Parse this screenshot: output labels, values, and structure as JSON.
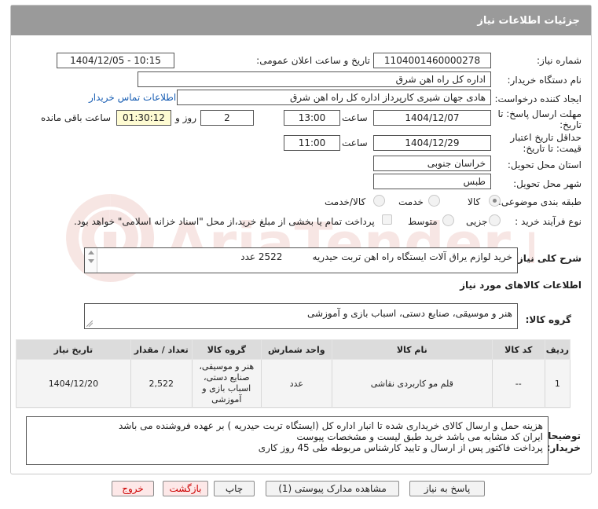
{
  "header": {
    "title": "جزئیات اطلاعات نیاز"
  },
  "fields": {
    "need_number_label": "شماره نیاز:",
    "need_number": "1104001460000278",
    "announce_label": "تاریخ و ساعت اعلان عمومی:",
    "announce_value": "1404/12/05 - 10:15",
    "buyer_org_label": "نام دستگاه خریدار:",
    "buyer_org": "اداره کل راه اهن شرق",
    "requester_label": "ایجاد کننده درخواست:",
    "requester": "هادی جهان شیری کارپرداز اداره کل راه اهن شرق",
    "contact_link": "اطلاعات تماس خریدار",
    "reply_deadline_label_1": "مهلت ارسال پاسخ: تا",
    "reply_deadline_label_2": "تاریخ:",
    "reply_date": "1404/12/07",
    "time_label": "ساعت",
    "reply_time": "13:00",
    "days_value": "2",
    "days_label": "روز و",
    "remaining_time": "01:30:12",
    "remaining_label": "ساعت باقی مانده",
    "validity_label_1": "حداقل تاریخ اعتبار",
    "validity_label_2": "قیمت: تا تاریخ:",
    "validity_date": "1404/12/29",
    "validity_time": "11:00",
    "province_label": "استان محل تحویل:",
    "province": "خراسان جنوبی",
    "city_label": "شهر محل تحویل:",
    "city": "طبس",
    "category_label": "طبقه بندی موضوعی:",
    "category_options": [
      "کالا",
      "خدمت",
      "کالا/خدمت"
    ],
    "process_label": "نوع فرآیند خرید :",
    "process_options": [
      "جزیی",
      "متوسط"
    ],
    "treasury_text": "پرداخت تمام یا بخشی از مبلغ خرید،از محل \"اسناد خزانه اسلامی\" خواهد بود."
  },
  "description": {
    "label": "شرح کلی نیاز:",
    "value": "خرید لوازم یراق آلات ایستگاه راه اهن تربت حیدریه          2522 عدد"
  },
  "goods": {
    "section_title": "اطلاعات کالاهای مورد نیاز",
    "group_label": "گروه کالا:",
    "group_value": "هنر و موسیقی، صنایع دستی، اسباب بازی و آموزشی",
    "columns": [
      "ردیف",
      "کد کالا",
      "نام کالا",
      "واحد شمارش",
      "گروه کالا",
      "تعداد / مقدار",
      "تاریخ نیاز"
    ],
    "rows": [
      {
        "index": "1",
        "code": "--",
        "name": "قلم مو کاربردی نقاشی",
        "unit": "عدد",
        "group": "هنر و موسیقی، صنایع دستی، اسباب بازی و آموزشی",
        "qty": "2,522",
        "date": "1404/12/20"
      }
    ]
  },
  "notes": {
    "label_1": "توضیحات",
    "label_2": "خریدار:",
    "lines": [
      "هزینه حمل و ارسال کالای خریداری شده تا انبار اداره کل (ایستگاه تربت حیدریه ) بر عهده فروشنده می باشد",
      "ایران کد مشابه می باشد خرید طبق لیست و مشخصات پیوست",
      "پرداخت فاکتور پس از ارسال و تایید کارشناس مربوطه طی 45 روز کاری"
    ]
  },
  "buttons": {
    "reply": "پاسخ به نیاز",
    "attachments": "مشاهده مدارک پیوستی (1)",
    "print": "چاپ",
    "back": "بازگشت",
    "exit": "خروج"
  },
  "watermark": {
    "brand": "AriaTender.net"
  },
  "colors": {
    "header_bg": "#9a9a9a",
    "highlight": "#fefbd2",
    "link": "#1a5fb4",
    "exit_text": "#cc0000"
  }
}
